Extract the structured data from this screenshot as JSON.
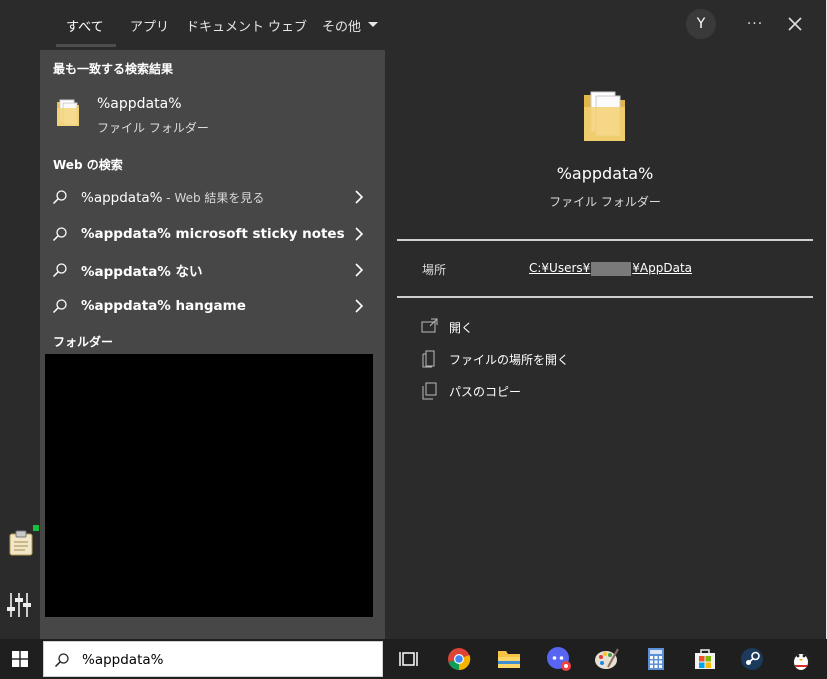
{
  "tabs": [
    {
      "label": "すべて",
      "active": true
    },
    {
      "label": "アプリ"
    },
    {
      "label": "ドキュメント"
    },
    {
      "label": "ウェブ"
    },
    {
      "label": "その他"
    }
  ],
  "header": {
    "avatar_initial": "Y",
    "more_label": "···"
  },
  "results": {
    "best_match_heading": "最も一致する検索結果",
    "best_match": {
      "title": "%appdata%",
      "subtitle": "ファイル フォルダー",
      "icon": "folder-icon"
    },
    "web_heading": "Web の検索",
    "web_items": [
      {
        "query": "%appdata%",
        "suffix": " - Web 結果を見る"
      },
      {
        "query": "%appdata% microsoft sticky notes",
        "suffix": ""
      },
      {
        "query": "%appdata% ない",
        "suffix": ""
      },
      {
        "query": "%appdata% hangame",
        "suffix": ""
      }
    ],
    "folders_heading": "フォルダー"
  },
  "detail": {
    "title": "%appdata%",
    "subtitle": "ファイル フォルダー",
    "location_label": "場所",
    "location_prefix": "C:¥Users¥",
    "location_suffix": "¥AppData",
    "actions": [
      {
        "label": "開く",
        "icon": "open-icon"
      },
      {
        "label": "ファイルの場所を開く",
        "icon": "file-location-icon"
      },
      {
        "label": "パスのコピー",
        "icon": "copy-path-icon"
      }
    ]
  },
  "taskbar": {
    "search_value": "%appdata%",
    "apps": [
      "task-view-icon",
      "chrome-icon",
      "file-explorer-icon",
      "discord-icon",
      "paint-icon",
      "calculator-icon",
      "store-icon",
      "steam-icon",
      "penguin-app-icon"
    ]
  },
  "colors": {
    "panel_left": "#474747",
    "panel_right": "#2b2b2b",
    "window": "#2b2b2b",
    "taskbar": "#1f1f1f"
  }
}
